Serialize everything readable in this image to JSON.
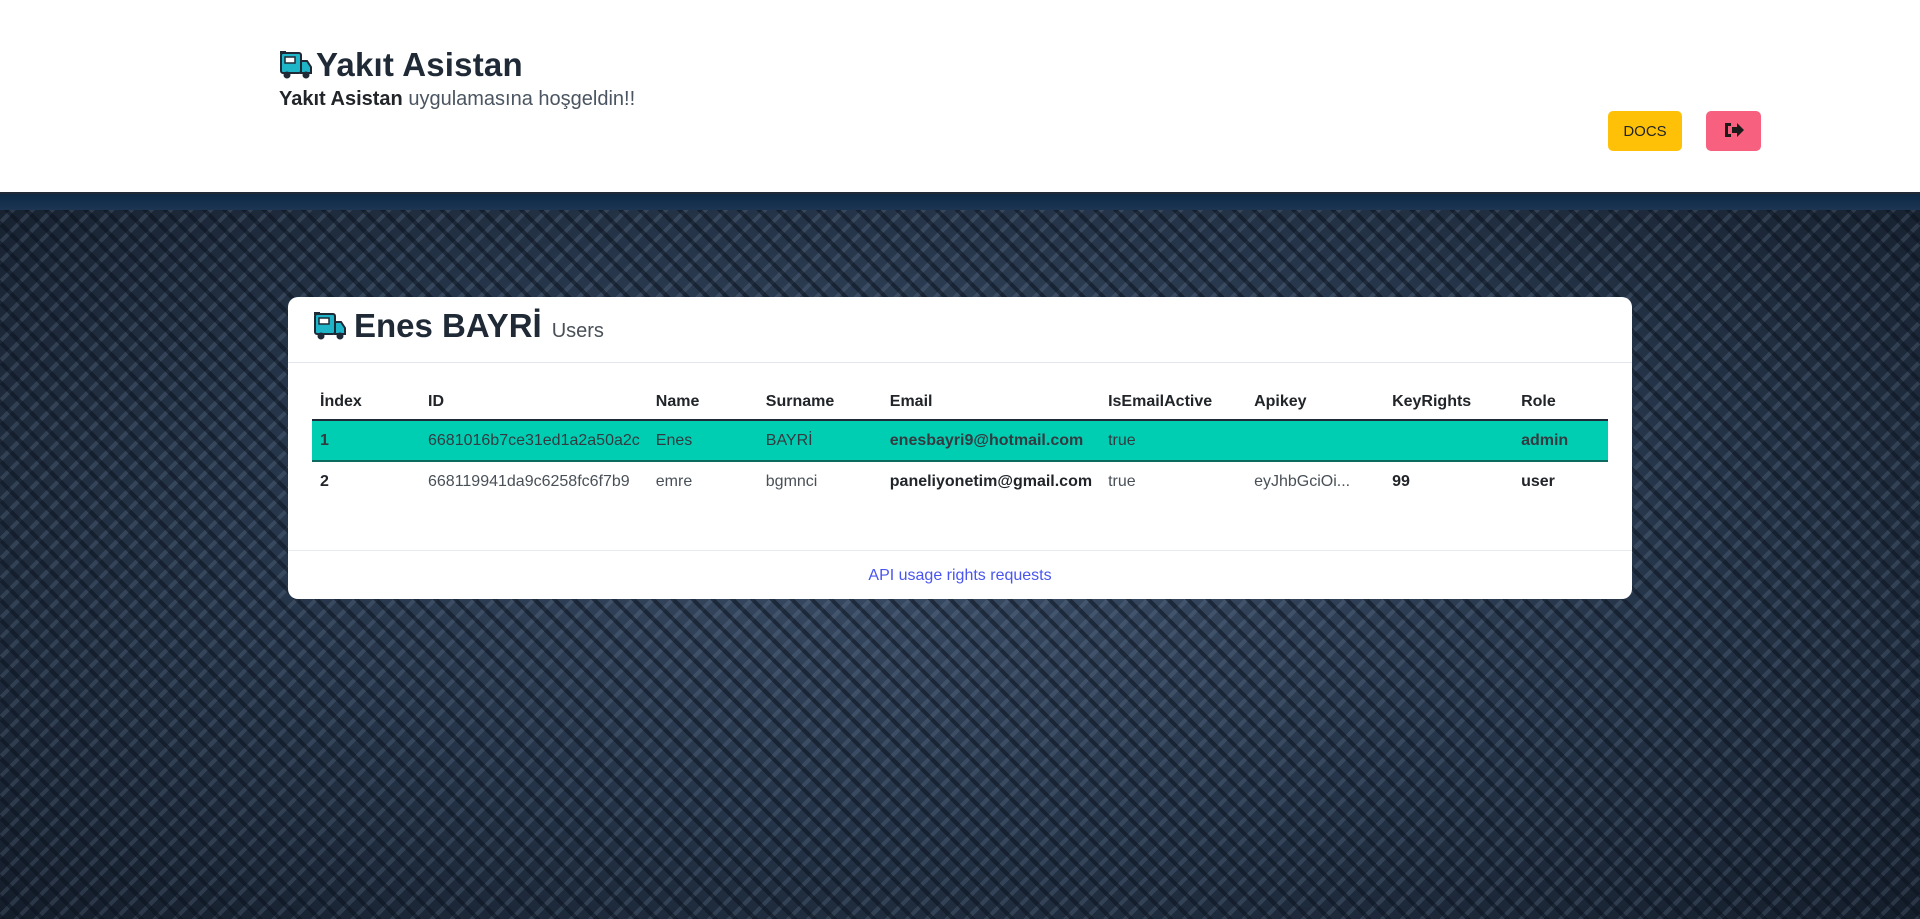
{
  "header": {
    "app_title": "Yakıt Asistan",
    "welcome_bold": "Yakıt Asistan",
    "welcome_rest": " uygulamasına hoşgeldin!!",
    "docs_label": "DOCS",
    "logout_icon": "sign-out-icon",
    "logo_icon": "fuel-truck-icon"
  },
  "card": {
    "title": "Enes BAYRİ",
    "subtitle": "Users",
    "footer_link": "API usage rights requests"
  },
  "table": {
    "columns": [
      "İndex",
      "ID",
      "Name",
      "Surname",
      "Email",
      "IsEmailActive",
      "Apikey",
      "KeyRights",
      "Role"
    ],
    "rows": [
      {
        "index": "1",
        "id": "6681016b7ce31ed1a2a50a2c",
        "name": "Enes",
        "surname": "BAYRİ",
        "email": "enesbayri9@hotmail.com",
        "is_email_active": "true",
        "apikey": "",
        "key_rights": "",
        "role": "admin"
      },
      {
        "index": "2",
        "id": "668119941da9c6258fc6f7b9",
        "name": "emre",
        "surname": "bgmnci",
        "email": "paneliyonetim@gmail.com",
        "is_email_active": "true",
        "apikey": "eyJhbGciOi...",
        "key_rights": "99",
        "role": "user"
      }
    ]
  },
  "colors": {
    "docs_button": "#ffc107",
    "logout_button": "#f7607f",
    "active_row": "#00ceb3",
    "link": "#4a55f0"
  }
}
